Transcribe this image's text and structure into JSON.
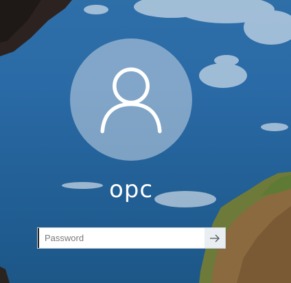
{
  "user": {
    "name": "opc"
  },
  "login": {
    "password_placeholder": "Password",
    "password_value": ""
  },
  "icons": {
    "avatar": "user-silhouette-icon",
    "submit": "arrow-right-icon"
  },
  "colors": {
    "sky": "#2a6aa6",
    "avatar_circle": "#c8d7e6",
    "text": "#ffffff"
  }
}
